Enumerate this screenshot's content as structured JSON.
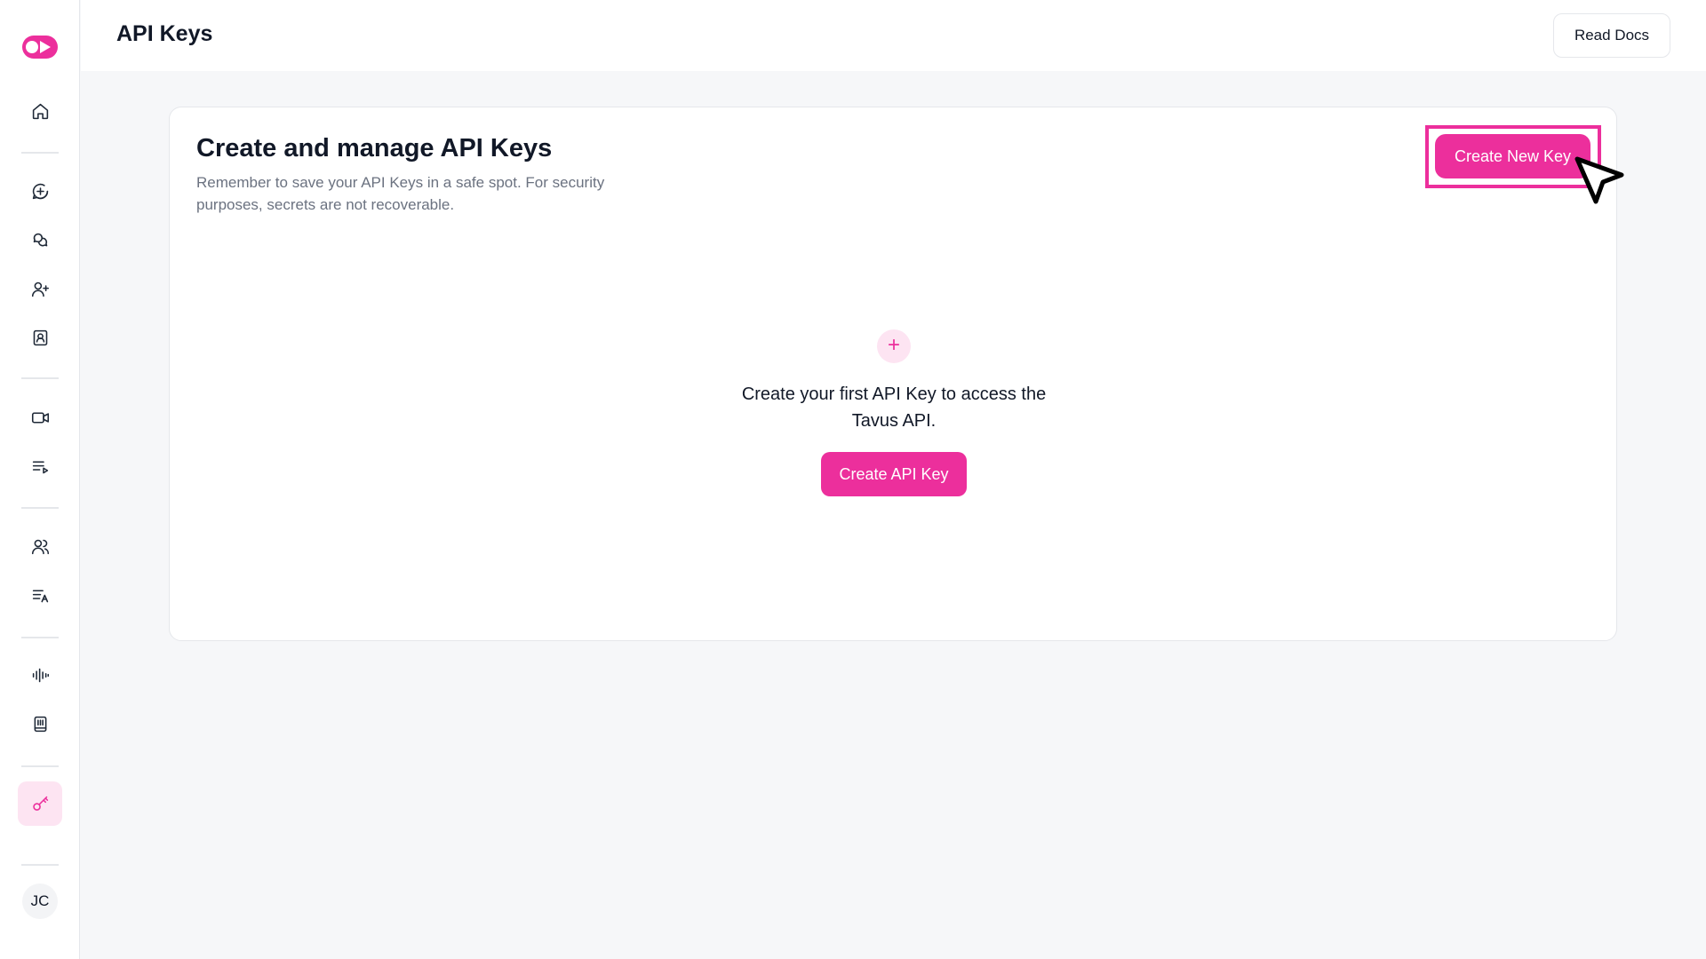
{
  "header": {
    "title": "API Keys",
    "read_docs_label": "Read Docs"
  },
  "sidebar": {
    "logo_icon": "tavus-logo-icon",
    "items": [
      {
        "icon": "home-icon",
        "active": false
      },
      {
        "icon": "chat-plus-icon",
        "active": false
      },
      {
        "icon": "conversations-icon",
        "active": false
      },
      {
        "icon": "user-plus-icon",
        "active": false
      },
      {
        "icon": "contact-book-icon",
        "active": false
      },
      {
        "icon": "video-icon",
        "active": false
      },
      {
        "icon": "playlist-icon",
        "active": false
      },
      {
        "icon": "users-icon",
        "active": false
      },
      {
        "icon": "translate-list-icon",
        "active": false
      },
      {
        "icon": "audio-wave-icon",
        "active": false
      },
      {
        "icon": "notebook-icon",
        "active": false
      },
      {
        "icon": "key-icon",
        "active": true
      }
    ],
    "user_initials": "JC"
  },
  "card": {
    "title": "Create and manage API Keys",
    "subtitle": "Remember to save your API Keys in a safe spot. For security purposes, secrets are not recoverable.",
    "create_new_label": "Create New Key"
  },
  "empty_state": {
    "icon": "plus-icon",
    "message": "Create your first API Key to access the Tavus API.",
    "create_label": "Create API Key"
  },
  "colors": {
    "accent": "#ec2f9c",
    "accent_soft": "#fde4f2",
    "background": "#f6f7f9"
  }
}
